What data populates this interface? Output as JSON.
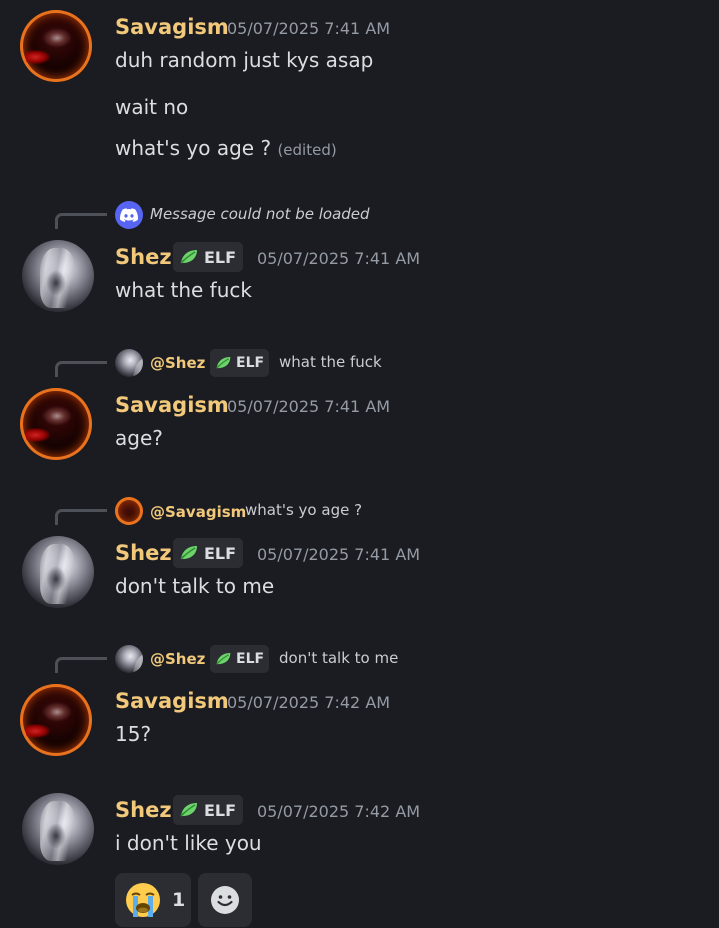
{
  "users": {
    "savagism": "Savagism",
    "shez": "Shez"
  },
  "tag_label": "ELF",
  "messages": [
    {
      "author": "Savagism",
      "timestamp": "05/07/2025 7:41 AM",
      "lines": [
        "duh random just kys asap",
        "wait no",
        "what's yo age ?"
      ],
      "edited_label": "(edited)"
    },
    {
      "reply": {
        "text": "Message could not be loaded"
      },
      "author": "Shez",
      "timestamp": "05/07/2025 7:41 AM",
      "lines": [
        "what the fuck"
      ]
    },
    {
      "reply": {
        "mention": "@Shez",
        "text": "what the fuck"
      },
      "author": "Savagism",
      "timestamp": "05/07/2025 7:41 AM",
      "lines": [
        "age?"
      ]
    },
    {
      "reply": {
        "mention": "@Savagism",
        "text": "what's yo age ?"
      },
      "author": "Shez",
      "timestamp": "05/07/2025 7:41 AM",
      "lines": [
        "don't talk to me"
      ]
    },
    {
      "reply": {
        "mention": "@Shez",
        "text": "don't talk to me"
      },
      "author": "Savagism",
      "timestamp": "05/07/2025 7:42 AM",
      "lines": [
        "15?"
      ]
    },
    {
      "author": "Shez",
      "timestamp": "05/07/2025 7:42 AM",
      "lines": [
        "i don't like you"
      ],
      "reactions": [
        {
          "emoji": "crying-face",
          "count": "1"
        },
        {
          "emoji": "add-reaction"
        }
      ]
    }
  ],
  "colors": {
    "background": "#1b1c21",
    "username": "#f2c97b",
    "timestamp": "#949ba4",
    "text": "#dbdee1",
    "tag_bg": "#2b2d33",
    "blurple": "#5865f2",
    "leaf": "#5ec45a"
  }
}
